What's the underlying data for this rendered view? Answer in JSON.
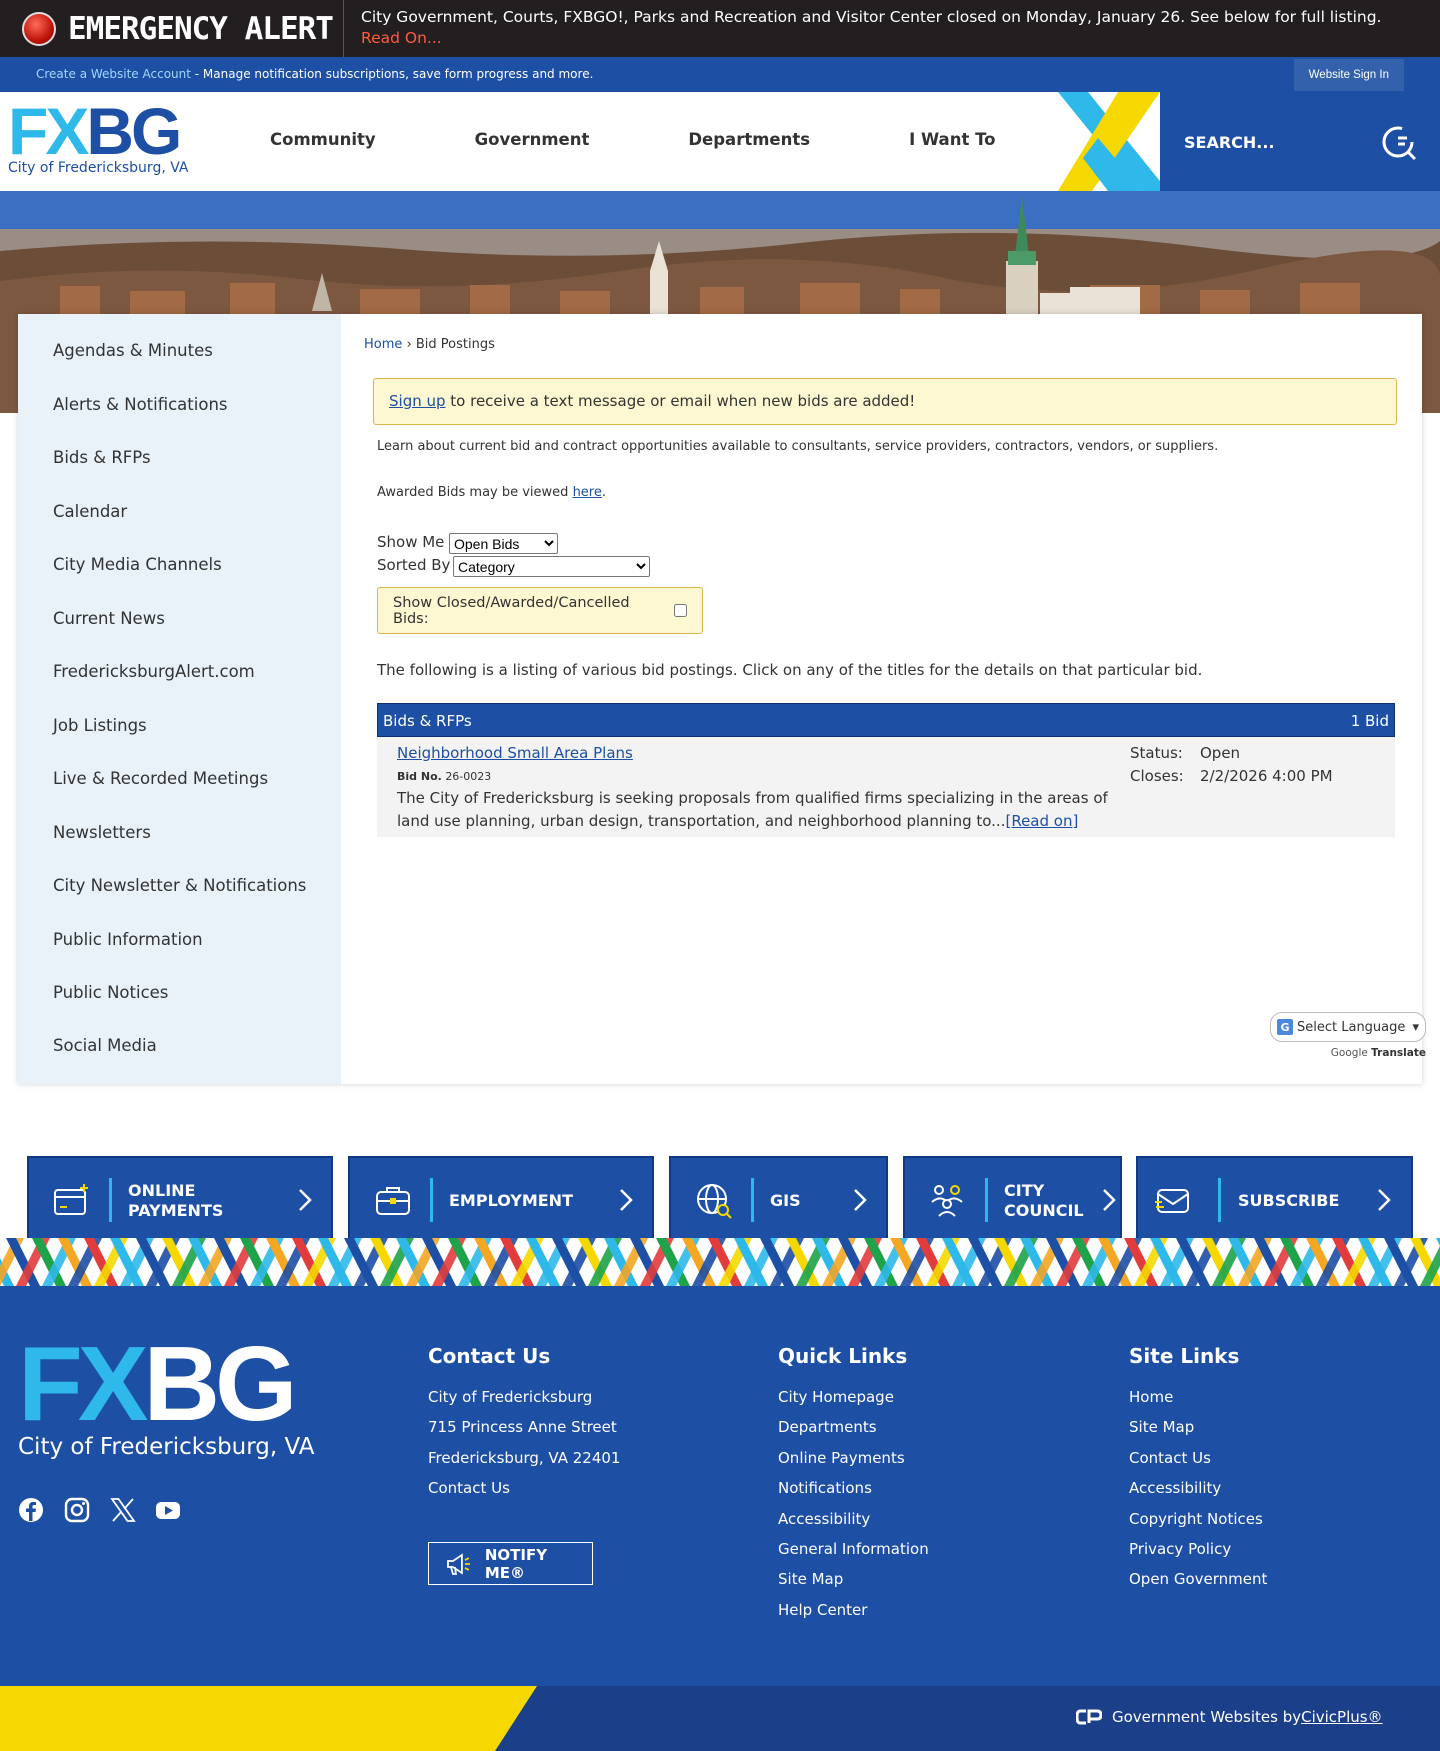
{
  "alert": {
    "title": "EMERGENCY ALERT",
    "message": "City Government, Courts, FXBGO!, Parks and Recreation and Visitor Center closed on Monday, January 26. See below for full listing.",
    "read_on": "Read On..."
  },
  "account_bar": {
    "create_link": "Create a Website Account",
    "description": " - Manage notification subscriptions, save form progress and more.",
    "sign_in": "Website Sign In"
  },
  "header": {
    "logo_fx": "FX",
    "logo_bg": "BG",
    "logo_sub": "City of Fredericksburg, VA",
    "nav": [
      "Community",
      "Government",
      "Departments",
      "I Want To"
    ],
    "search_placeholder": "SEARCH..."
  },
  "sidebar": {
    "items": [
      "Agendas & Minutes",
      "Alerts & Notifications",
      "Bids & RFPs",
      "Calendar",
      "City Media Channels",
      "Current News",
      "FredericksburgAlert.com",
      "Job Listings",
      "Live & Recorded Meetings",
      "Newsletters",
      "City Newsletter & Notifications",
      "Public Information",
      "Public Notices",
      "Social Media"
    ]
  },
  "main": {
    "breadcrumb_home": "Home",
    "breadcrumb_sep": " › ",
    "breadcrumb_current": "Bid Postings",
    "signup_link": "Sign up",
    "signup_text": " to receive a text message or email when new bids are added!",
    "intro": "Learn about current bid and contract opportunities available to consultants, service providers, contractors, vendors, or suppliers.",
    "awarded_text": "Awarded Bids may be viewed ",
    "awarded_link": "here",
    "awarded_end": ".",
    "show_me_label": "Show Me",
    "show_me_value": "Open Bids",
    "sorted_by_label": "Sorted By",
    "sorted_by_value": "Category",
    "closed_label": "Show Closed/Awarded/Cancelled Bids:",
    "listing_text": "The following is a listing of various bid postings. Click on any of the titles for the details on that particular bid.",
    "category": "Bids & RFPs",
    "count": "1 Bid",
    "bid": {
      "title": "Neighborhood Small Area Plans",
      "no_label": "Bid No.",
      "no_value": "26-0023",
      "description": "The City of Fredericksburg is seeking proposals from qualified firms specializing in the areas of land use planning, urban design, transportation, and neighborhood planning to...",
      "read_on": "[Read on]",
      "status_label": "Status:",
      "status_value": "Open",
      "closes_label": "Closes:",
      "closes_value": "2/2/2026 4:00 PM"
    }
  },
  "translate": {
    "select": "Select Language",
    "google": "Google",
    "translate": "Translate"
  },
  "tiles": [
    {
      "line1": "ONLINE",
      "line2": "PAYMENTS"
    },
    {
      "line1": "EMPLOYMENT",
      "line2": ""
    },
    {
      "line1": "GIS",
      "line2": ""
    },
    {
      "line1": "CITY",
      "line2": "COUNCIL"
    },
    {
      "line1": "SUBSCRIBE",
      "line2": ""
    }
  ],
  "footer": {
    "logo_fx": "FX",
    "logo_bg": "BG",
    "logo_sub": "City of Fredericksburg, VA",
    "contact": {
      "heading": "Contact Us",
      "lines": [
        "City of Fredericksburg",
        "715 Princess Anne Street",
        "Fredericksburg, VA 22401",
        "Contact Us"
      ],
      "notify": "NOTIFY ME®"
    },
    "quick": {
      "heading": "Quick Links",
      "links": [
        "City Homepage",
        "Departments",
        "Online Payments",
        "Notifications",
        "Accessibility",
        "General Information",
        "Site Map",
        "Help Center"
      ]
    },
    "site": {
      "heading": "Site Links",
      "links": [
        "Home",
        "Site Map",
        "Contact Us",
        "Accessibility",
        "Copyright Notices",
        "Privacy Policy",
        "Open Government"
      ]
    },
    "credit_text": "Government Websites by ",
    "credit_link": "CivicPlus®"
  },
  "colors": {
    "primary_blue": "#1d4fa5",
    "light_blue": "#2fb8ea",
    "yellow": "#f5d800",
    "alert_bg": "#231f20",
    "notice_bg": "#fdf7d2"
  }
}
